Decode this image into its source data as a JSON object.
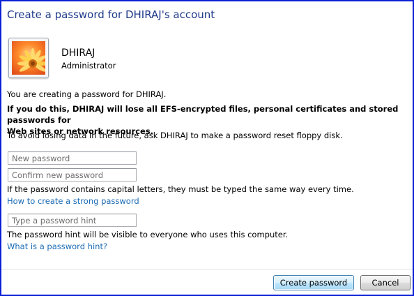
{
  "window": {
    "title": "Create a password for DHIRAJ's account"
  },
  "user": {
    "name": "DHIRAJ",
    "role": "Administrator",
    "avatar_icon": "flower-avatar-icon"
  },
  "messages": {
    "intro": "You are creating a password for DHIRAJ.",
    "warning_line1": "If you do this, DHIRAJ will lose all EFS-encrypted files, personal certificates and stored passwords for",
    "warning_line2": "Web sites or network resources.",
    "advice": "To avoid losing data in the future, ask DHIRAJ to make a password reset floppy disk.",
    "case_note": "If the password contains capital letters, they must be typed the same way every time.",
    "hint_note": "The password hint will be visible to everyone who uses this computer."
  },
  "fields": {
    "new_password": {
      "placeholder": "New password",
      "value": ""
    },
    "confirm_password": {
      "placeholder": "Confirm new password",
      "value": ""
    },
    "password_hint": {
      "placeholder": "Type a password hint",
      "value": ""
    }
  },
  "links": {
    "strong_password": "How to create a strong password",
    "what_is_hint": "What is a password hint?"
  },
  "buttons": {
    "create": "Create password",
    "cancel": "Cancel"
  },
  "colors": {
    "border": "#0a1fd6",
    "title": "#1e3a8a",
    "link": "#1a6bb5"
  }
}
